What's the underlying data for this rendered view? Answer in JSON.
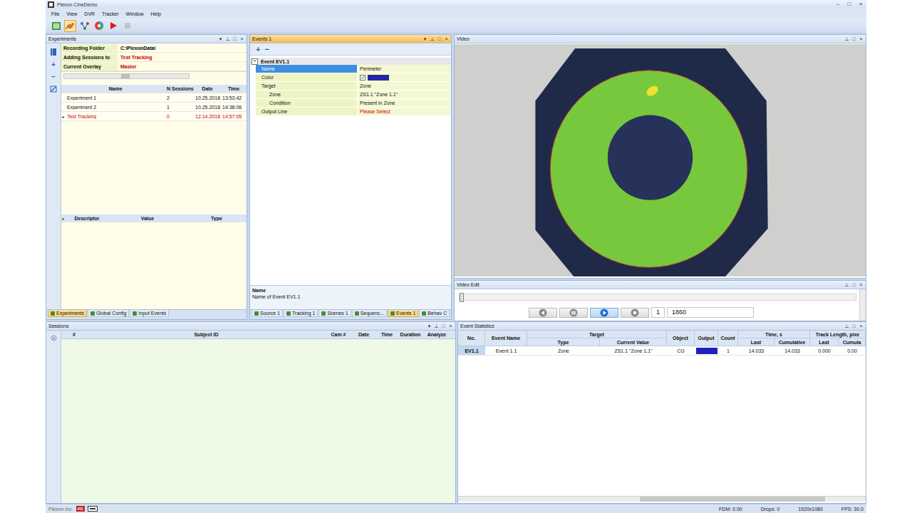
{
  "window": {
    "title": "Plexon CineDemo",
    "controls": [
      "–",
      "□",
      "×"
    ]
  },
  "menu": [
    "File",
    "View",
    "DVR",
    "Tracker",
    "Window",
    "Help"
  ],
  "toolbar": [
    {
      "kind": "experiment",
      "selected": false,
      "disabled": false
    },
    {
      "kind": "tracker",
      "selected": true,
      "disabled": false
    },
    {
      "kind": "network",
      "selected": false,
      "disabled": false
    },
    {
      "kind": "color",
      "selected": false,
      "disabled": false
    },
    {
      "kind": "play",
      "selected": false,
      "disabled": false
    },
    {
      "kind": "stop",
      "selected": false,
      "disabled": true
    }
  ],
  "pane_controls": [
    "▾",
    "⊥",
    "□",
    "×"
  ],
  "experiments_panel": {
    "title": "Experiments",
    "side_tools": [
      "+",
      "−"
    ],
    "properties": [
      {
        "label": "Recording Folder",
        "value": "C:\\PlexonData\\",
        "color": "#000000"
      },
      {
        "label": "Adding Sessions to",
        "value": "Test Tracking",
        "color": "#cc0000"
      },
      {
        "label": "Current Overlay",
        "value": "Master",
        "color": "#cc0000"
      }
    ],
    "table": {
      "marker": "▸",
      "columns": [
        "Name",
        "N Sessions",
        "Date",
        "Time"
      ],
      "rows": [
        {
          "cells": [
            "Experiment 1",
            "2",
            "10.25.2018",
            "13:53:42"
          ],
          "selected": false,
          "current": false
        },
        {
          "cells": [
            "Experiment 2",
            "1",
            "10.25.2018",
            "14:38:06"
          ],
          "selected": false,
          "current": false
        },
        {
          "cells": [
            "Test Tracking",
            "0",
            "12.14.2018",
            "14:57:05"
          ],
          "selected": true,
          "current": true
        }
      ]
    },
    "descriptors": {
      "marker": "▸",
      "columns": [
        "Descriptor",
        "Value",
        "Type"
      ]
    },
    "tabs": [
      {
        "label": "Experiments",
        "selected": true
      },
      {
        "label": "Global Config",
        "selected": false
      },
      {
        "label": "Input Events",
        "selected": false
      }
    ]
  },
  "events_panel": {
    "title": "Events 1",
    "active": true,
    "tools": [
      "+",
      "−"
    ],
    "group": {
      "expander": "−",
      "label": "Event EV1.1"
    },
    "properties": [
      {
        "label": "Name",
        "value": "Perimeter",
        "kind": "text",
        "selected": true,
        "indent": false,
        "warning": false
      },
      {
        "label": "Color",
        "value": "",
        "kind": "color",
        "checked": true,
        "color": "#2424b8",
        "selected": false,
        "indent": false,
        "warning": false
      },
      {
        "label": "Target",
        "value": "Zone",
        "kind": "text",
        "selected": false,
        "indent": false,
        "warning": false
      },
      {
        "label": "Zone",
        "value": "ZS1.1 \"Zone 1.1\"",
        "kind": "text",
        "selected": false,
        "indent": true,
        "warning": false
      },
      {
        "label": "Condition",
        "value": "Present in Zone",
        "kind": "text",
        "selected": false,
        "indent": true,
        "warning": false
      },
      {
        "label": "Output Line",
        "value": "Please Select",
        "kind": "text",
        "selected": false,
        "indent": false,
        "warning": true
      }
    ],
    "description": {
      "title": "Name",
      "text": "Name of Event EV1.1"
    },
    "tabs": [
      {
        "label": "Source 1",
        "selected": false
      },
      {
        "label": "Tracking 1",
        "selected": false
      },
      {
        "label": "Scenes 1",
        "selected": false
      },
      {
        "label": "Sequenc...",
        "selected": false
      },
      {
        "label": "Events 1",
        "selected": true
      },
      {
        "label": "Behav C",
        "selected": false
      }
    ]
  },
  "video_panel": {
    "title": "Video"
  },
  "video_edit": {
    "title": "Video Edit",
    "level": 0.0,
    "buttons": [
      {
        "kind": "prev",
        "selected": false
      },
      {
        "kind": "pause",
        "selected": false
      },
      {
        "kind": "play",
        "selected": true
      },
      {
        "kind": "stop",
        "selected": false
      }
    ],
    "start": "1",
    "end": "1860"
  },
  "sessions": {
    "title": "Sessions",
    "columns": [
      "#",
      "Subject ID",
      "Cam #",
      "Date",
      "Time",
      "Duration",
      "Analyze"
    ]
  },
  "event_statistics": {
    "title": "Event Statistics",
    "header": [
      {
        "label": "No.",
        "sub": []
      },
      {
        "label": "Event Name",
        "sub": []
      },
      {
        "label": "Target",
        "sub": [
          "Type",
          "Current Value"
        ]
      },
      {
        "label": "Object",
        "sub": []
      },
      {
        "label": "Output",
        "sub": []
      },
      {
        "label": "Count",
        "sub": []
      },
      {
        "label": "Time, s",
        "sub": [
          "Last",
          "Cumulative"
        ]
      },
      {
        "label": "Track Length, pixe",
        "sub": [
          "Last",
          "Cumula"
        ]
      }
    ],
    "rows": [
      {
        "no": "EV1.1",
        "selected": true,
        "cells": [
          "Event 1.1",
          "Zone",
          "ZS1.1 \"Zone 1.1\"",
          "CG"
        ],
        "output_color": "#2020c0",
        "after": [
          "1",
          "14.033",
          "14.033",
          "0.000",
          "0.00"
        ]
      }
    ]
  },
  "status_bar": {
    "company": "Plexon Inc.",
    "badge": "I/O",
    "items": [
      "FDM: 0.00",
      "Drops: 0",
      "1920x1080",
      "FPS: 30.0"
    ]
  }
}
